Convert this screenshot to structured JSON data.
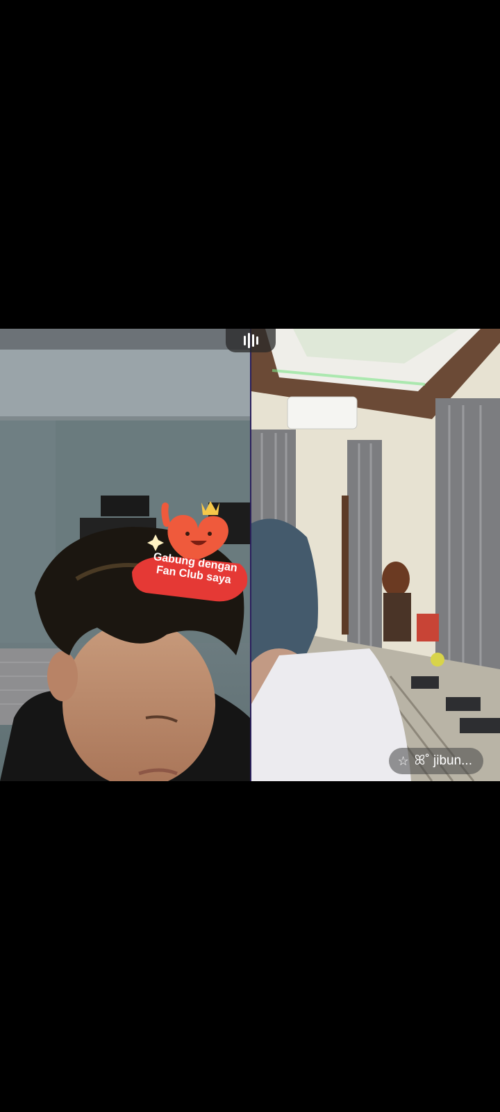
{
  "left_panel": {
    "sticker": {
      "text": "Gabung dengan\nFan Club saya"
    }
  },
  "right_panel": {
    "username_pill": {
      "label": "ꕤ˚ jibun..."
    }
  },
  "icons": {
    "pause": "pause-bars-icon",
    "star": "star-outline-icon"
  },
  "colors": {
    "background": "#000000",
    "divider": "#2a1f5c",
    "sticker_red": "#e53935"
  }
}
